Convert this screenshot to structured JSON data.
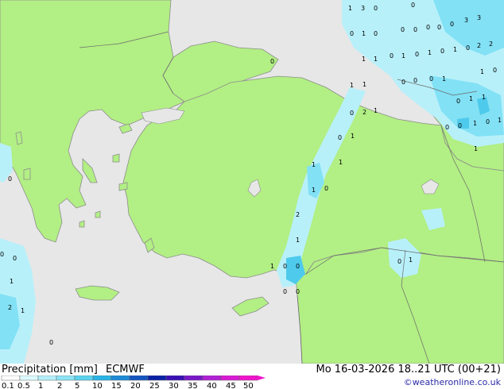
{
  "map": {
    "colors": {
      "sea": "#e7e7e7",
      "land": "#b2ef84",
      "coast": "#8d8d8d",
      "border": "#6a6a6a",
      "precip_light": "#b8f0fa",
      "precip_mid": "#82e1f5",
      "precip_strong": "#4ecaec"
    },
    "values": [
      "1",
      "3",
      "0",
      "0",
      "0",
      "0",
      "0",
      "0",
      "0",
      "3",
      "3",
      "0",
      "1",
      "0",
      "2",
      "2",
      "1",
      "1",
      "0",
      "1",
      "0",
      "1",
      "0",
      "1",
      "0",
      "0",
      "1",
      "0",
      "0",
      "0",
      "0",
      "1",
      "1",
      "1",
      "0",
      "1",
      "1",
      "0",
      "2",
      "1",
      "1",
      "0",
      "0",
      "0",
      "1",
      "0",
      "1",
      "1",
      "1",
      "1",
      "0",
      "1",
      "0",
      "2",
      "1",
      "0",
      "0",
      "0",
      "1",
      "1",
      "0",
      "0",
      "1",
      "0",
      "0",
      "2",
      "1",
      "0"
    ]
  },
  "footer": {
    "title": "Precipitation [mm]",
    "model": "ECMWF",
    "valid_time": "Mo 16-03-2026 18..21 UTC (00+21)",
    "credit": "©weatheronline.co.uk"
  },
  "legend": {
    "ticks": [
      "0.1",
      "0.5",
      "1",
      "2",
      "5",
      "10",
      "15",
      "20",
      "25",
      "30",
      "35",
      "40",
      "45",
      "50"
    ],
    "colors": [
      "#ffffff",
      "#dcfafe",
      "#b4f0fa",
      "#8ce4f4",
      "#5ad2ee",
      "#2ab4e6",
      "#1f8ad6",
      "#1456c0",
      "#0a22a4",
      "#3a10b4",
      "#7a18c8",
      "#b020d4",
      "#d81ad4",
      "#f014cc"
    ]
  }
}
